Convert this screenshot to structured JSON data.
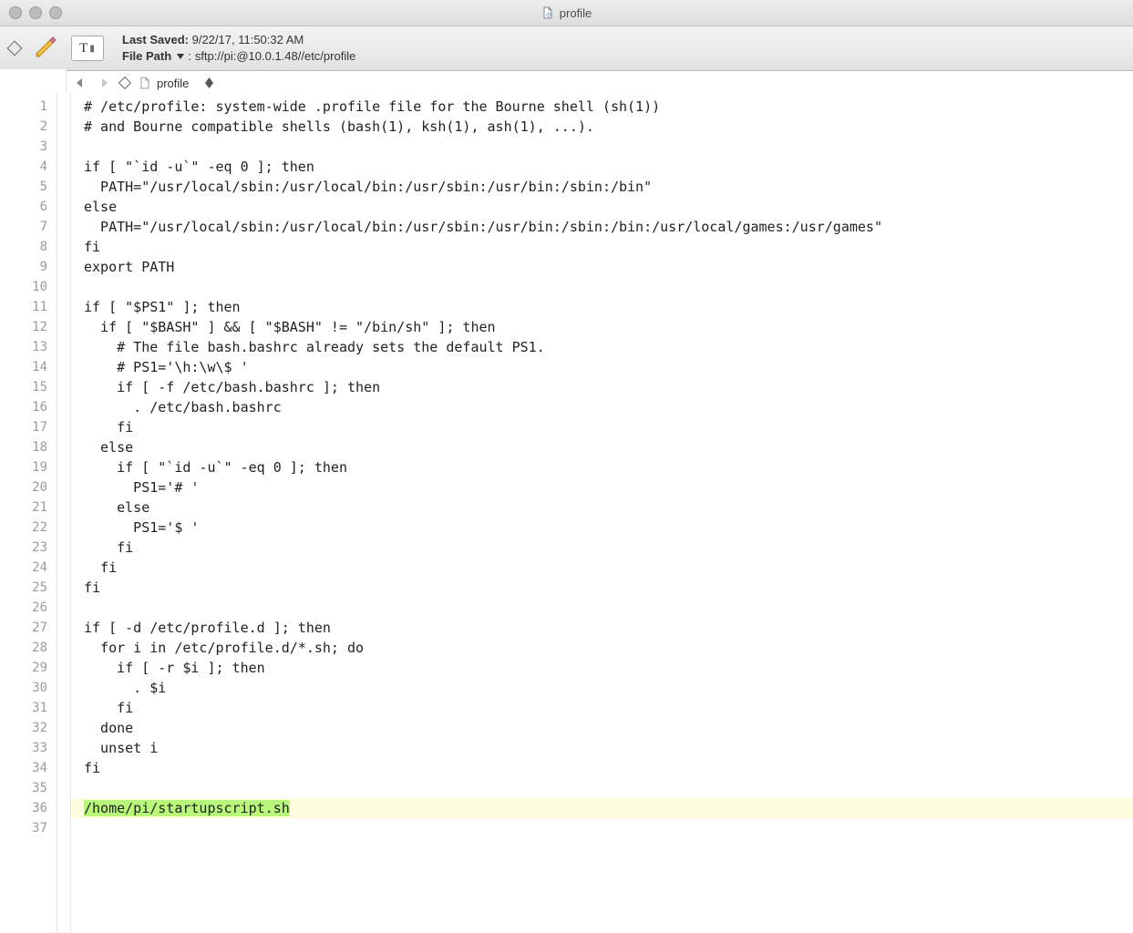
{
  "window": {
    "title": "profile"
  },
  "toolbar": {
    "last_saved_label": "Last Saved:",
    "last_saved_value": "9/22/17, 11:50:32 AM",
    "file_path_label": "File Path",
    "file_path_value": "sftp://pi:@10.0.1.48//etc/profile"
  },
  "nav": {
    "filename": "profile"
  },
  "code": {
    "lines": [
      "# /etc/profile: system-wide .profile file for the Bourne shell (sh(1))",
      "# and Bourne compatible shells (bash(1), ksh(1), ash(1), ...).",
      "",
      "if [ \"`id -u`\" -eq 0 ]; then",
      "  PATH=\"/usr/local/sbin:/usr/local/bin:/usr/sbin:/usr/bin:/sbin:/bin\"",
      "else",
      "  PATH=\"/usr/local/sbin:/usr/local/bin:/usr/sbin:/usr/bin:/sbin:/bin:/usr/local/games:/usr/games\"",
      "fi",
      "export PATH",
      "",
      "if [ \"$PS1\" ]; then",
      "  if [ \"$BASH\" ] && [ \"$BASH\" != \"/bin/sh\" ]; then",
      "    # The file bash.bashrc already sets the default PS1.",
      "    # PS1='\\h:\\w\\$ '",
      "    if [ -f /etc/bash.bashrc ]; then",
      "      . /etc/bash.bashrc",
      "    fi",
      "  else",
      "    if [ \"`id -u`\" -eq 0 ]; then",
      "      PS1='# '",
      "    else",
      "      PS1='$ '",
      "    fi",
      "  fi",
      "fi",
      "",
      "if [ -d /etc/profile.d ]; then",
      "  for i in /etc/profile.d/*.sh; do",
      "    if [ -r $i ]; then",
      "      . $i",
      "    fi",
      "  done",
      "  unset i",
      "fi",
      "",
      "/home/pi/startupscript.sh",
      ""
    ],
    "highlight_line_index": 35,
    "line_count": 37
  }
}
